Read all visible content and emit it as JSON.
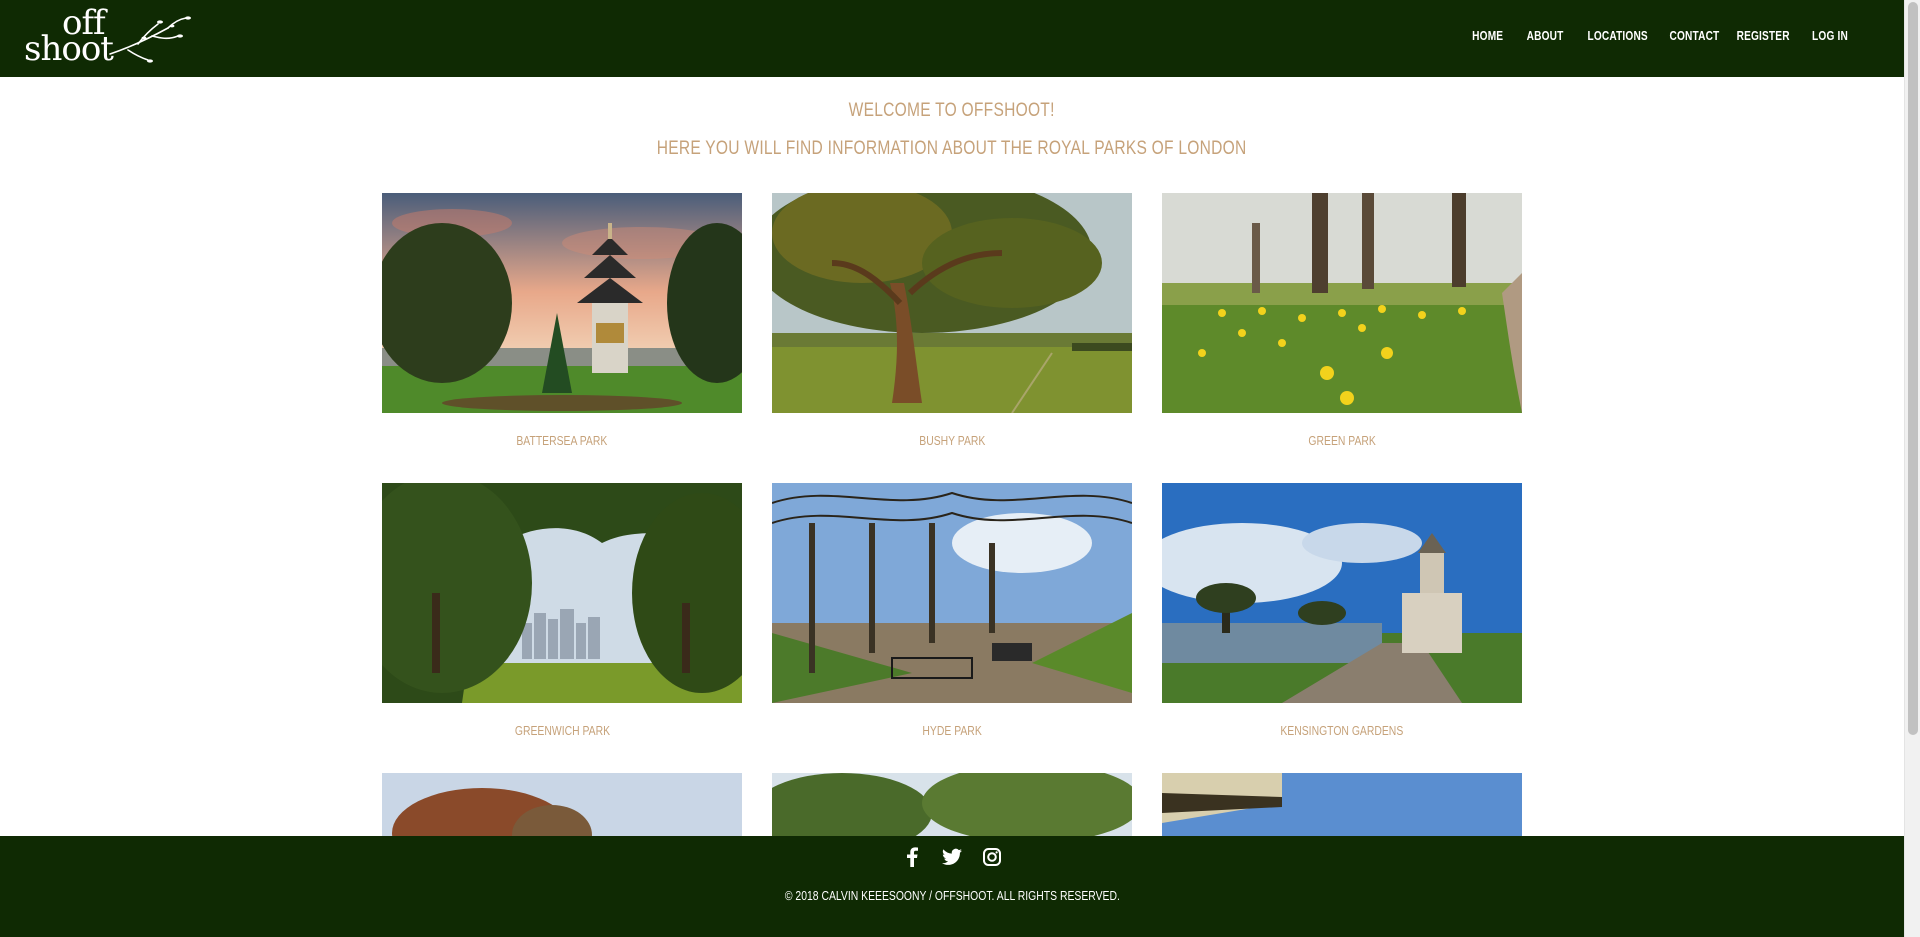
{
  "header": {
    "logo_top": "off",
    "logo_bottom": "shoot",
    "nav": [
      {
        "label": "HOME"
      },
      {
        "label": "ABOUT"
      },
      {
        "label": "LOCATIONS"
      },
      {
        "label": "CONTACT"
      },
      {
        "label": "REGISTER"
      },
      {
        "label": "LOG IN"
      }
    ]
  },
  "main": {
    "welcome": "WELCOME TO OFFSHOOT!",
    "subtitle": "HERE YOU WILL FIND INFORMATION ABOUT THE ROYAL PARKS OF LONDON",
    "parks": [
      {
        "name": "BATTERSEA PARK"
      },
      {
        "name": "BUSHY PARK"
      },
      {
        "name": "GREEN PARK"
      },
      {
        "name": "GREENWICH PARK"
      },
      {
        "name": "HYDE PARK"
      },
      {
        "name": "KENSINGTON GARDENS"
      }
    ]
  },
  "footer": {
    "social": [
      "facebook-icon",
      "twitter-icon",
      "instagram-icon"
    ],
    "copyright": "© 2018 CALVIN KEEESOONY / OFFSHOOT. ALL RIGHTS RESERVED."
  },
  "colors": {
    "header_bg": "#0f2a03",
    "accent_text": "#c6a27a"
  }
}
